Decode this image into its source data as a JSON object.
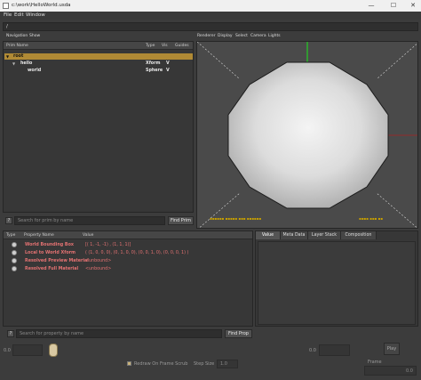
{
  "window": {
    "title": "c:\\work\\HelloWorld.usda",
    "minimize": "—",
    "maximize": "☐",
    "close": "✕"
  },
  "menubar": {
    "file": "File",
    "edit": "Edit",
    "window": "Window"
  },
  "path": {
    "value": "/"
  },
  "nav_menu": {
    "navigation": "Navigation",
    "show": "Show"
  },
  "prim_tree": {
    "columns": {
      "name": "Prim Name",
      "type": "Type",
      "vis": "Vis",
      "guides": "Guides"
    },
    "rows": [
      {
        "name": "root",
        "type": "",
        "vis": ""
      },
      {
        "name": "hello",
        "type": "Xform",
        "vis": "V"
      },
      {
        "name": "world",
        "type": "Sphere",
        "vis": "V"
      }
    ]
  },
  "prim_search": {
    "help": "?",
    "placeholder": "Search for prim by name",
    "button": "Find Prim"
  },
  "viewport_menu": {
    "renderer": "Renderer",
    "display": "Display",
    "select": "Select",
    "camera": "Camera",
    "lights": "Lights"
  },
  "properties": {
    "columns": {
      "type": "Type",
      "name": "Property Name",
      "value": "Value"
    },
    "rows": [
      {
        "name": "World Bounding Box",
        "value": "[( 1, -1, -1) , (1, 1, 1)]"
      },
      {
        "name": "Local to World Xform",
        "value": "( (1, 0, 0, 0), (0, 1, 0, 0), (0, 0, 1, 0), (0, 0, 0, 1) )"
      },
      {
        "name": "Resolved Preview Material",
        "value": "<unbound>"
      },
      {
        "name": "Resolved Full Material",
        "value": "<unbound>"
      }
    ]
  },
  "property_search": {
    "help": "?",
    "placeholder": "Search for property by name",
    "button": "Find Prop"
  },
  "inspector_tabs": [
    "Value",
    "Meta Data",
    "Layer Stack",
    "Composition"
  ],
  "timeline": {
    "start": "0.0",
    "end": "0.0",
    "play": "Play",
    "redraw": "Redraw On Frame Scrub",
    "step_label": "Step Size",
    "step_value": "1.0",
    "frame_label": "Frame",
    "frame_value": "0.0"
  },
  "colors": {
    "accent": "#b08a35",
    "property_text": "#e47272",
    "hud": "#c8a000"
  }
}
